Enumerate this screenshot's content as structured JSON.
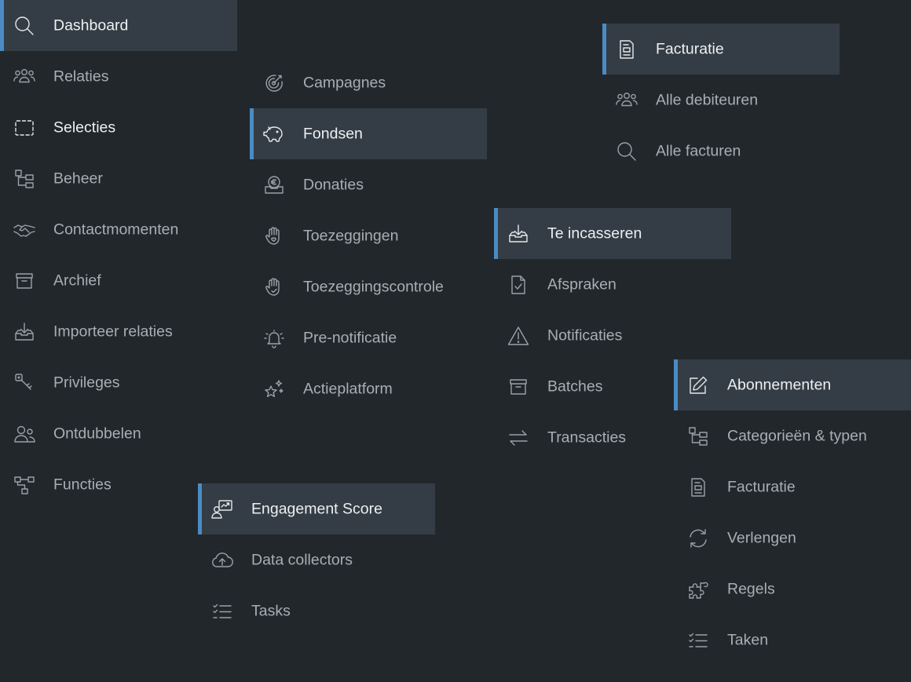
{
  "colors": {
    "background": "#22272b",
    "active_background": "#343d45",
    "accent": "#4b8bc4",
    "text": "#a8aeb3",
    "text_active": "#eef0f2"
  },
  "main_menu": {
    "items": [
      {
        "label": "Dashboard",
        "icon": "search-icon"
      },
      {
        "label": "Relaties",
        "icon": "users-icon"
      },
      {
        "label": "Selecties",
        "icon": "selection-icon"
      },
      {
        "label": "Beheer",
        "icon": "tree-icon"
      },
      {
        "label": "Contactmomenten",
        "icon": "handshake-icon"
      },
      {
        "label": "Archief",
        "icon": "archive-icon"
      },
      {
        "label": "Importeer relaties",
        "icon": "import-icon"
      },
      {
        "label": "Privileges",
        "icon": "key-icon"
      },
      {
        "label": "Ontdubbelen",
        "icon": "duplicate-users-icon"
      },
      {
        "label": "Functies",
        "icon": "hierarchy-icon"
      }
    ]
  },
  "campagnes_menu": {
    "items": [
      {
        "label": "Campagnes",
        "icon": "target-icon"
      },
      {
        "label": "Fondsen",
        "icon": "piggy-bank-icon"
      },
      {
        "label": "Donaties",
        "icon": "euro-tray-icon"
      },
      {
        "label": "Toezeggingen",
        "icon": "hand-heart-icon"
      },
      {
        "label": "Toezeggingscontrole",
        "icon": "hand-check-icon"
      },
      {
        "label": "Pre-notificatie",
        "icon": "bell-icon"
      },
      {
        "label": "Actieplatform",
        "icon": "stars-icon"
      }
    ]
  },
  "engagement_menu": {
    "items": [
      {
        "label": "Engagement Score",
        "icon": "user-chart-icon"
      },
      {
        "label": "Data collectors",
        "icon": "cloud-upload-icon"
      },
      {
        "label": "Tasks",
        "icon": "checklist-icon"
      }
    ]
  },
  "incasso_menu": {
    "items": [
      {
        "label": "Te incasseren",
        "icon": "tray-download-icon"
      },
      {
        "label": "Afspraken",
        "icon": "document-check-icon"
      },
      {
        "label": "Notificaties",
        "icon": "warning-icon"
      },
      {
        "label": "Batches",
        "icon": "archive-icon"
      },
      {
        "label": "Transacties",
        "icon": "transfer-icon"
      }
    ]
  },
  "facturatie_menu": {
    "items": [
      {
        "label": "Facturatie",
        "icon": "invoice-icon"
      },
      {
        "label": "Alle debiteuren",
        "icon": "users-icon"
      },
      {
        "label": "Alle facturen",
        "icon": "search-icon"
      }
    ]
  },
  "abonnementen_menu": {
    "items": [
      {
        "label": "Abonnementen",
        "icon": "edit-icon"
      },
      {
        "label": "Categorieën & typen",
        "icon": "tree-icon"
      },
      {
        "label": "Facturatie",
        "icon": "invoice-icon"
      },
      {
        "label": "Verlengen",
        "icon": "refresh-icon"
      },
      {
        "label": "Regels",
        "icon": "puzzle-icon"
      },
      {
        "label": "Taken",
        "icon": "checklist-icon"
      }
    ]
  }
}
